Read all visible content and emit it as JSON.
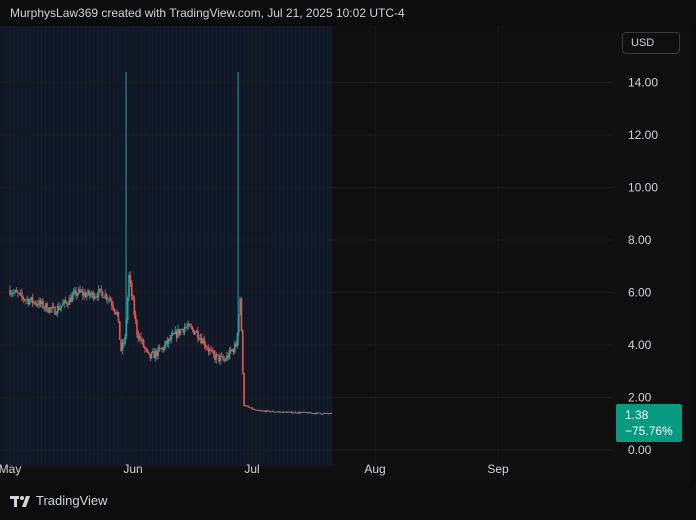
{
  "header": {
    "attribution": "MurphysLaw369 created with TradingView.com, Jul 21, 2025 10:02 UTC-4"
  },
  "currency_selector": {
    "label": "USD"
  },
  "last_price_badge": {
    "price": "1.38",
    "change": "−75.76%"
  },
  "footer": {
    "brand": "TradingView"
  },
  "colors": {
    "up": "#26a69a",
    "down": "#ef5350",
    "badge": "#089981",
    "background": "#0f0f0f",
    "session_highlight": "#101726"
  },
  "chart_data": {
    "type": "candlestick",
    "y_axis": {
      "ticks": [
        0,
        2,
        4,
        6,
        8,
        10,
        12,
        14
      ],
      "tick_labels": [
        "0.00",
        "2.00",
        "4.00",
        "6.00",
        "8.00",
        "10.00",
        "12.00",
        "14.00"
      ],
      "ylim": [
        0,
        15.4
      ]
    },
    "x_axis": {
      "tick_labels": [
        "May",
        "Jun",
        "Jul",
        "Aug",
        "Sep"
      ],
      "tick_dates": [
        "2025-05-01",
        "2025-06-01",
        "2025-07-01",
        "2025-08-01",
        "2025-09-01"
      ],
      "range": [
        "2025-05-01",
        "2025-09-22"
      ]
    },
    "grid": true,
    "data_end_date": "2025-07-21",
    "spikes": [
      {
        "date": "2025-05-30",
        "high": 14.4,
        "color": "up"
      },
      {
        "date": "2025-06-27",
        "high": 14.4,
        "color": "up"
      }
    ],
    "price_path": [
      [
        "2025-05-01",
        6.1
      ],
      [
        "2025-05-04",
        5.8
      ],
      [
        "2025-05-08",
        5.6
      ],
      [
        "2025-05-12",
        5.3
      ],
      [
        "2025-05-15",
        5.6
      ],
      [
        "2025-05-18",
        6.0
      ],
      [
        "2025-05-21",
        5.9
      ],
      [
        "2025-05-24",
        6.0
      ],
      [
        "2025-05-26",
        5.8
      ],
      [
        "2025-05-28",
        5.2
      ],
      [
        "2025-05-29",
        3.8
      ],
      [
        "2025-05-30",
        4.2
      ],
      [
        "2025-05-31",
        6.6
      ],
      [
        "2025-06-02",
        4.5
      ],
      [
        "2025-06-05",
        3.5
      ],
      [
        "2025-06-08",
        3.8
      ],
      [
        "2025-06-11",
        4.3
      ],
      [
        "2025-06-14",
        4.7
      ],
      [
        "2025-06-17",
        4.5
      ],
      [
        "2025-06-19",
        4.1
      ],
      [
        "2025-06-21",
        3.6
      ],
      [
        "2025-06-24",
        3.4
      ],
      [
        "2025-06-26",
        3.8
      ],
      [
        "2025-06-27",
        4.0
      ],
      [
        "2025-06-28",
        5.8
      ],
      [
        "2025-06-29",
        1.7
      ],
      [
        "2025-07-02",
        1.5
      ],
      [
        "2025-07-08",
        1.45
      ],
      [
        "2025-07-14",
        1.42
      ],
      [
        "2025-07-21",
        1.38
      ]
    ]
  }
}
